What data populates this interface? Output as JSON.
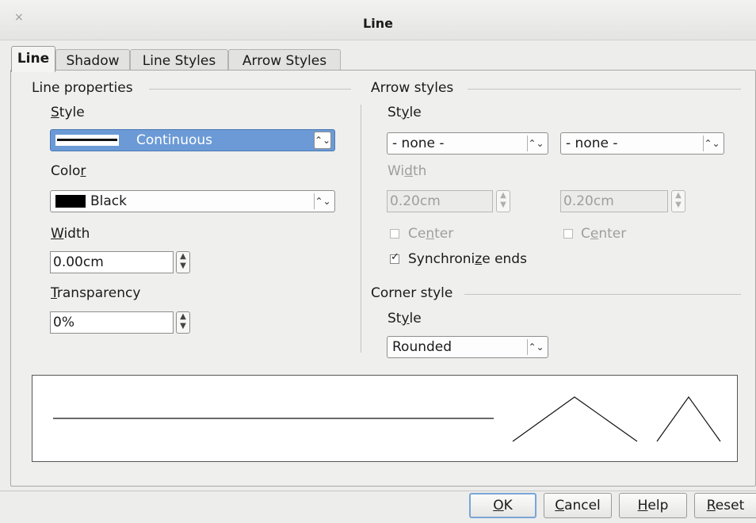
{
  "window": {
    "title": "Line",
    "close_glyph": "×"
  },
  "tabs": [
    {
      "label": "Line",
      "active": true
    },
    {
      "label": "Shadow"
    },
    {
      "label": "Line Styles"
    },
    {
      "label": "Arrow Styles"
    }
  ],
  "line_properties": {
    "header": "Line properties",
    "style": {
      "label": "Style",
      "value": "Continuous"
    },
    "color": {
      "label": "Color",
      "value": "Black",
      "swatch": "#000000"
    },
    "width": {
      "label": "Width",
      "value": "0.00cm"
    },
    "transparency": {
      "label": "Transparency",
      "value": "0%"
    }
  },
  "arrow_styles": {
    "header": "Arrow styles",
    "style_label": "Style",
    "start_style": "- none -",
    "end_style": "- none -",
    "width_label": "Width",
    "start_width": "0.20cm",
    "end_width": "0.20cm",
    "center_start_label": "Center",
    "center_end_label": "Center",
    "synchronize_label": "Synchronize ends",
    "synchronize_checked": true
  },
  "corner_style": {
    "header": "Corner style",
    "style_label": "Style",
    "value": "Rounded"
  },
  "buttons": {
    "ok": "OK",
    "cancel": "Cancel",
    "help": "Help",
    "reset": "Reset"
  },
  "colors": {
    "selection": "#6b9ad6",
    "background": "#ededec"
  }
}
